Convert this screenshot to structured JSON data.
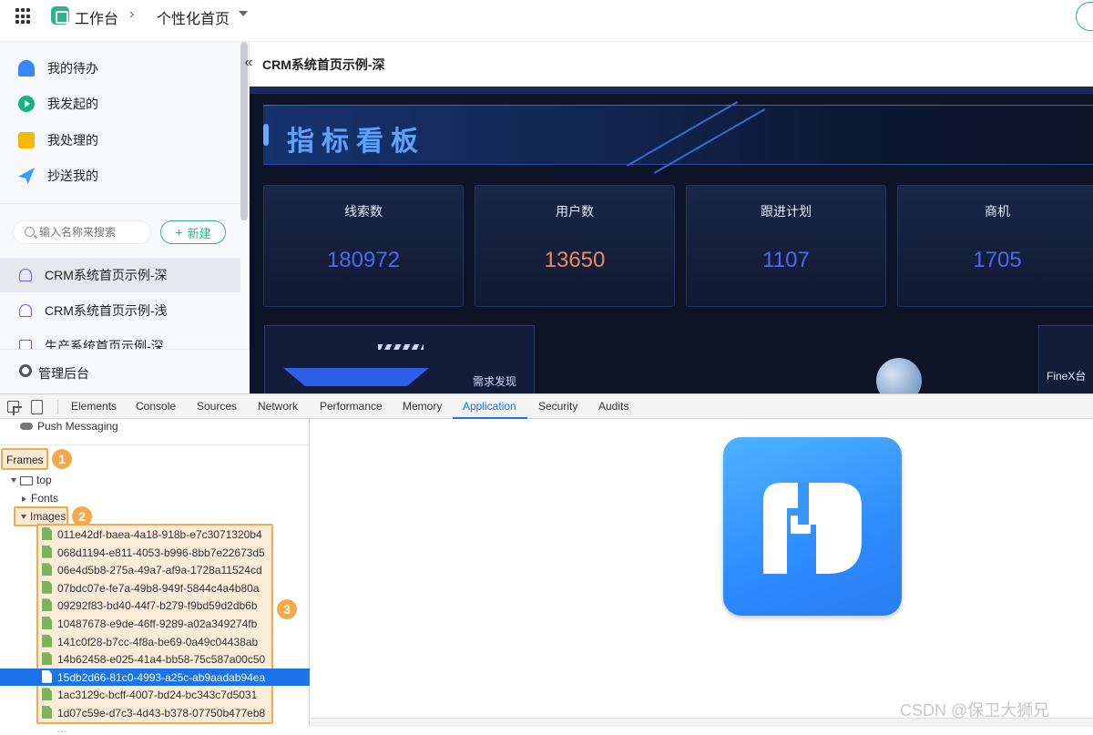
{
  "topbar": {
    "app_title": "工作台",
    "breadcrumb_sep": "›",
    "page_select": "个性化首页"
  },
  "sidebar": {
    "nav": [
      {
        "label": "我的待办",
        "icon": "bell-icon"
      },
      {
        "label": "我发起的",
        "icon": "play-icon"
      },
      {
        "label": "我处理的",
        "icon": "inbox-icon"
      },
      {
        "label": "抄送我的",
        "icon": "paper-plane-icon"
      }
    ],
    "search_placeholder": "输入名称来搜索",
    "new_button": "新建",
    "pages": [
      {
        "label": "CRM系统首页示例-深",
        "active": true
      },
      {
        "label": "CRM系统首页示例-浅",
        "active": false
      },
      {
        "label": "生产系统首页示例-深",
        "active": false
      }
    ],
    "admin": "管理后台"
  },
  "content": {
    "title": "CRM系统首页示例-深",
    "collapse_glyph": "«"
  },
  "dashboard": {
    "banner_title": "指标看板",
    "kpis": [
      {
        "label": "线索数",
        "value": "180972",
        "color": "#4f68f0"
      },
      {
        "label": "用户数",
        "value": "13650",
        "color": "#f08a5d"
      },
      {
        "label": "跟进计划",
        "value": "1107",
        "color": "#4f68f0"
      },
      {
        "label": "商机",
        "value": "1705",
        "color": "#4f68f0"
      }
    ],
    "panel_left_label": "需求发现",
    "panel_right_label": "FineX台"
  },
  "devtools": {
    "tabs": [
      "Elements",
      "Console",
      "Sources",
      "Network",
      "Performance",
      "Memory",
      "Application",
      "Security",
      "Audits"
    ],
    "active_tab": "Application",
    "push_messaging": "Push Messaging",
    "frames": "Frames",
    "top": "top",
    "fonts": "Fonts",
    "images": "Images",
    "badges": [
      "1",
      "2",
      "3"
    ],
    "files": [
      "011e42df-baea-4a18-918b-e7c3071320b4",
      "068d1194-e811-4053-b996-8bb7e22673d5",
      "06e4d5b8-275a-49a7-af9a-1728a11524cd",
      "07bdc07e-fe7a-49b8-949f-5844c4a4b80a",
      "09292f83-bd40-44f7-b279-f9bd59d2db6b",
      "10487678-e9de-46ff-9289-a02a349274fb",
      "141c0f28-b7cc-4f8a-be69-0a49c04438ab",
      "14b62458-e025-41a4-bb58-75c587a00c50",
      "15db2d66-81c0-4993-a25c-ab9aadab94ea",
      "1ac3129c-bcff-4007-bd24-bc343c7d5031",
      "1d07c59e-d7c3-4d43-b378-07750b477eb8"
    ],
    "selected_file_index": 8
  },
  "watermark": "CSDN @保卫大狮兄",
  "colors": {
    "accent_green": "#2fb38a",
    "devtools_blue": "#1a73e8",
    "highlight_orange": "#f5a94a"
  }
}
